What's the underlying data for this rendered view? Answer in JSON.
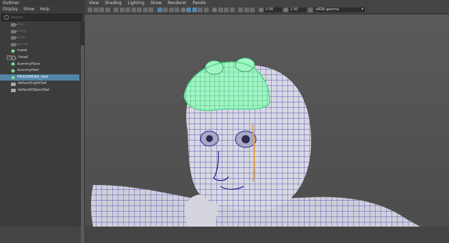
{
  "outliner": {
    "title": "Outliner",
    "menu": [
      "Display",
      "Show",
      "Help"
    ],
    "search_placeholder": "Search...",
    "items": [
      {
        "label": "top",
        "icon": "camera-icon",
        "dim": true
      },
      {
        "label": "front",
        "icon": "camera-icon",
        "dim": true
      },
      {
        "label": "side",
        "icon": "camera-icon",
        "dim": true
      },
      {
        "label": "persp",
        "icon": "camera-icon",
        "dim": true
      },
      {
        "label": "mask",
        "icon": "mesh-icon",
        "dim": false
      },
      {
        "label": "head",
        "icon": "group-icon",
        "dim": false
      },
      {
        "label": "dummyFace",
        "icon": "mesh-icon",
        "dim": false
      },
      {
        "label": "dummyHair",
        "icon": "mesh-icon",
        "dim": false
      },
      {
        "label": "HEADWEAR_test",
        "icon": "mesh-icon",
        "dim": false,
        "selected": true
      },
      {
        "label": "defaultLightSet",
        "icon": "set-icon",
        "dim": false
      },
      {
        "label": "defaultObjectSet",
        "icon": "set-icon",
        "dim": false
      }
    ]
  },
  "viewport": {
    "menu": [
      "View",
      "Shading",
      "Lighting",
      "Show",
      "Renderer",
      "Panels"
    ],
    "exposure": "0.00",
    "gamma_value": "1.00",
    "color_space": "sRGB gamma"
  },
  "colors": {
    "selection": "#5285a6",
    "wire": "#1f1f8c",
    "selected_mesh": "#7ef0a8"
  }
}
